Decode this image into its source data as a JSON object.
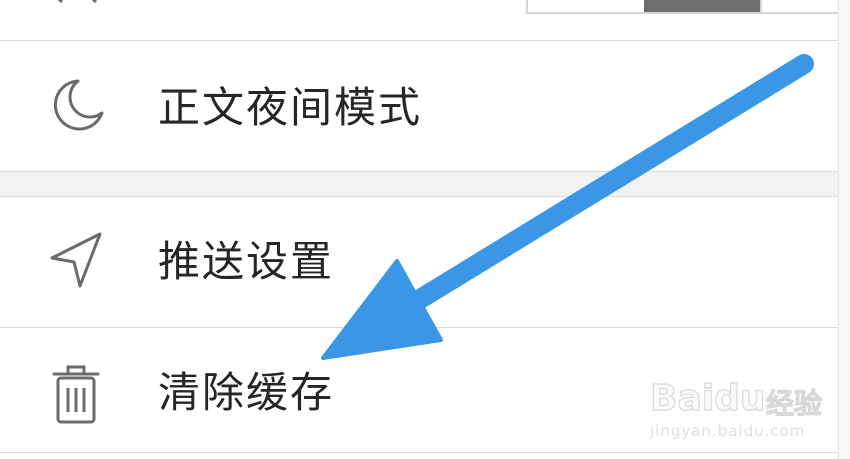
{
  "settings": {
    "items": [
      {
        "label": "正文夜间模式",
        "icon": "moon-icon"
      },
      {
        "label": "推送设置",
        "icon": "send-icon"
      },
      {
        "label": "清除缓存",
        "icon": "trash-icon"
      }
    ]
  },
  "watermark": {
    "brand": "Baidu",
    "cn": "经验",
    "url": "jingyan.baidu.com"
  },
  "colors": {
    "arrow": "#3a96e6",
    "text": "#262626",
    "divider": "#dcdcdc",
    "icon": "#6b6b6b"
  }
}
